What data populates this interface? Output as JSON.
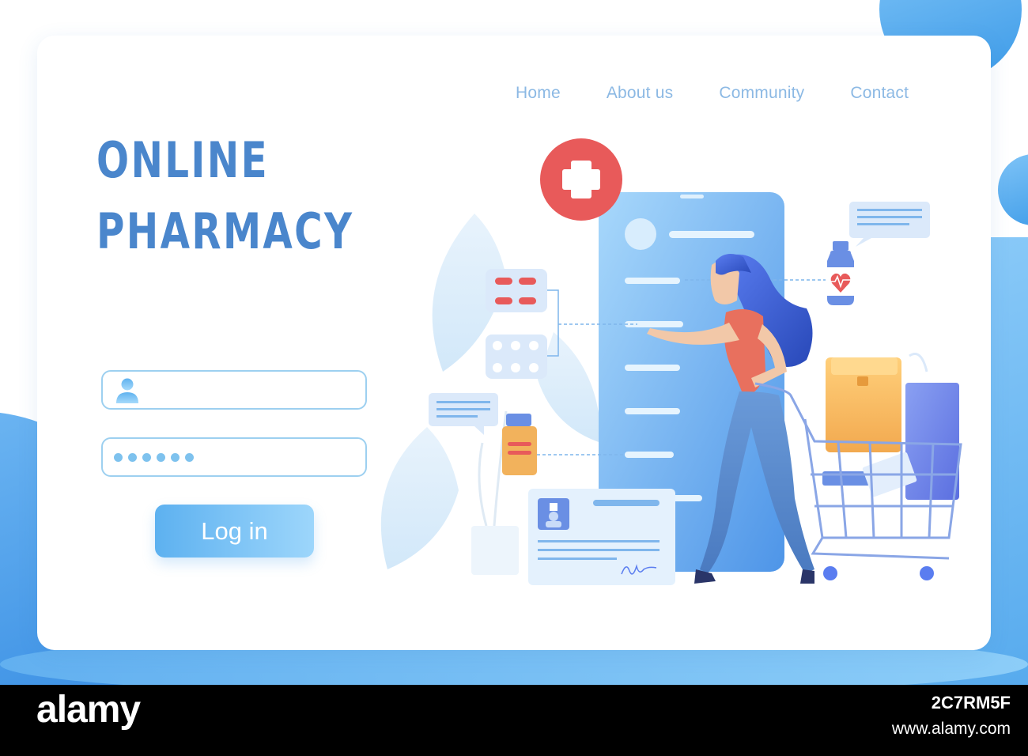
{
  "nav": {
    "items": [
      "Home",
      "About us",
      "Community",
      "Contact"
    ]
  },
  "hero": {
    "line1": "ONLINE",
    "line2": "PHARMACY"
  },
  "login": {
    "username_value": "",
    "password_masked": "••••••",
    "button_label": "Log in"
  },
  "footer": {
    "logo": "alamy",
    "image_id": "2C7RM5F",
    "url": "www.alamy.com"
  },
  "colors": {
    "primary": "#4a86cc",
    "nav": "#8cb9e4",
    "accent_red": "#e85a5a",
    "button": "#5db1f0"
  },
  "icons": [
    "user-icon",
    "plus-cross-icon",
    "heart-pulse-icon",
    "shopping-cart-icon",
    "signature-icon"
  ]
}
